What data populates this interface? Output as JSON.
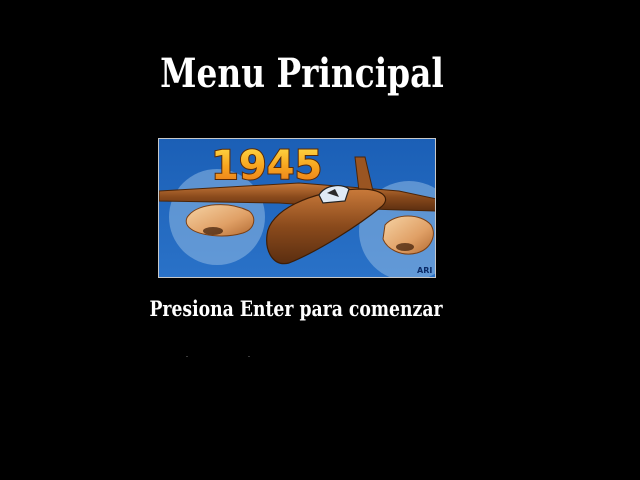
{
  "menu": {
    "title": "Menu Principal",
    "prompt": "Presiona Enter para comenzar"
  },
  "banner": {
    "game_title": "1945",
    "signature": "ARI",
    "icon": "propeller-plane-illustration"
  },
  "colors": {
    "background": "#000000",
    "text": "#ffffff",
    "banner_sky": "#1f63b8",
    "title_orange": "#f29a1c",
    "title_yellow": "#ffd83a",
    "plane_brown": "#8a4a1c"
  }
}
